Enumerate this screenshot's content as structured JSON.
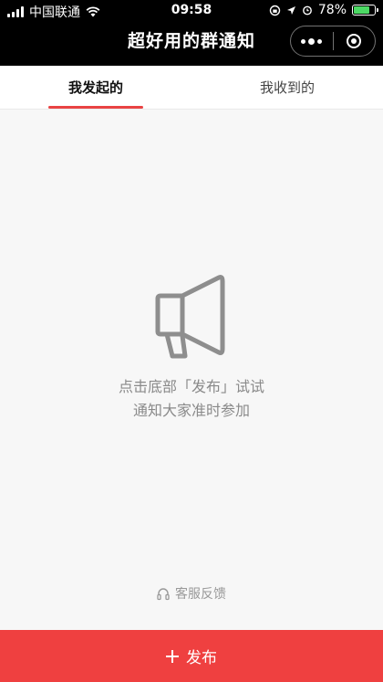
{
  "status_bar": {
    "carrier": "中国联通",
    "time": "09:58",
    "battery": "78%",
    "battery_level": 0.78
  },
  "nav": {
    "title": "超好用的群通知"
  },
  "tabs": [
    {
      "label": "我发起的",
      "active": true
    },
    {
      "label": "我收到的",
      "active": false
    }
  ],
  "empty_state": {
    "icon": "megaphone-icon",
    "line1": "点击底部「发布」试试",
    "line2": "通知大家准时参加"
  },
  "service": {
    "icon": "headset-icon",
    "label": "客服反馈"
  },
  "publish": {
    "icon": "plus-icon",
    "label": "发布"
  },
  "colors": {
    "accent": "#ef4040",
    "background": "#f7f7f7"
  }
}
